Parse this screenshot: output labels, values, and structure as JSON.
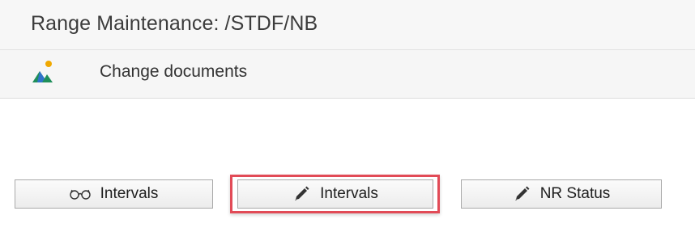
{
  "header": {
    "title": "Range Maintenance: /STDF/NB"
  },
  "toolbar": {
    "change_documents": "Change documents",
    "icon": "change-documents-icon"
  },
  "buttons": {
    "display_intervals": {
      "label": "Intervals",
      "icon": "glasses-icon"
    },
    "change_intervals": {
      "label": "Intervals",
      "icon": "pencil-icon"
    },
    "nr_status": {
      "label": "NR Status",
      "icon": "pencil-icon"
    }
  },
  "colors": {
    "highlight": "#e24b57",
    "icon_green": "#1f8f5a",
    "icon_orange": "#f0a800",
    "icon_blue": "#2f73c9"
  }
}
